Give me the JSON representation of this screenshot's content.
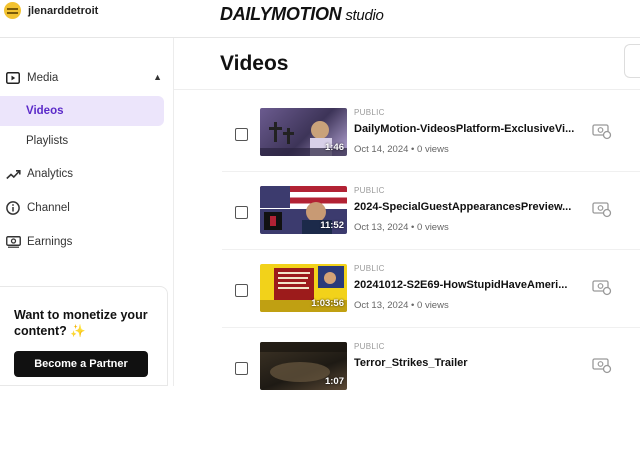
{
  "topbar": {
    "username": "jlenarddetroit",
    "brand": "DAILYMOTION",
    "brand_suffix": "studio"
  },
  "sidebar": {
    "media_label": "Media",
    "sub_items": [
      {
        "label": "Videos",
        "active": true
      },
      {
        "label": "Playlists",
        "active": false
      }
    ],
    "items": [
      {
        "label": "Analytics",
        "icon": "trend-icon"
      },
      {
        "label": "Channel",
        "icon": "info-icon"
      },
      {
        "label": "Earnings",
        "icon": "money-icon"
      }
    ],
    "promo": {
      "text": "Want to monetize your content?",
      "emoji": "✨",
      "button": "Become a Partner"
    }
  },
  "main": {
    "title": "Videos",
    "videos": [
      {
        "visibility": "PUBLIC",
        "title": "DailyMotion-VideosPlatform-ExclusiveVi...",
        "date": "Oct 14, 2024",
        "views": "0 views",
        "duration": "1:46"
      },
      {
        "visibility": "PUBLIC",
        "title": "2024-SpecialGuestAppearancesPreview...",
        "date": "Oct 13, 2024",
        "views": "0 views",
        "duration": "11:52"
      },
      {
        "visibility": "PUBLIC",
        "title": "20241012-S2E69-HowStupidHaveAmeri...",
        "date": "Oct 13, 2024",
        "views": "0 views",
        "duration": "1:03:56"
      },
      {
        "visibility": "PUBLIC",
        "title": "Terror_Strikes_Trailer",
        "date": "",
        "views": "",
        "duration": "1:07"
      }
    ],
    "separator": "•"
  },
  "colors": {
    "accent": "#5b2ac9",
    "active_bg": "#ece5fb",
    "button_bg": "#111111"
  }
}
